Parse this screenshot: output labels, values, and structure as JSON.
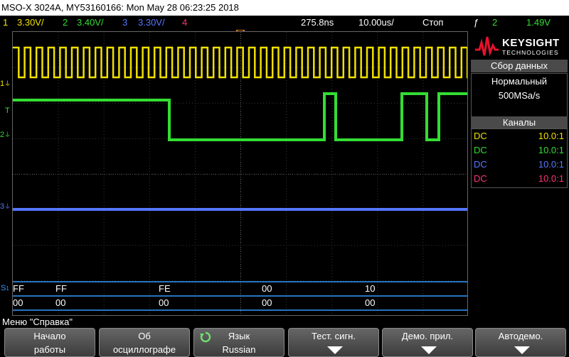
{
  "title": "MSO-X 3024A, MY53160166: Mon May 28 06:23:25 2018",
  "status": {
    "ch1": {
      "num": "1",
      "scale": "3.30V/",
      "color": "#f0e000"
    },
    "ch2": {
      "num": "2",
      "scale": "3.40V/",
      "color": "#33dd33"
    },
    "ch3": {
      "num": "3",
      "scale": "3.30V/",
      "color": "#5577ff"
    },
    "ch4": {
      "num": "4",
      "color": "#ff3377"
    },
    "delay": "275.8ns",
    "timebase": "10.00us/",
    "run_state": "Стоп",
    "trigger_source": "2",
    "trigger_level": "1.49V"
  },
  "markers": {
    "ch1": "1",
    "ch2": "2",
    "ch3": "3",
    "trig": "T",
    "serial": "S"
  },
  "serial_bus": {
    "row1": [
      "FF",
      "FF",
      "FE",
      "00",
      "10"
    ],
    "row2": [
      "00",
      "00",
      "00",
      "00",
      "00"
    ]
  },
  "right_panel": {
    "brand": "KEYSIGHT",
    "brand_sub": "TECHNOLOGIES",
    "acq_header": "Сбор данных",
    "acq_mode": "Нормальный",
    "acq_rate": "500MSa/s",
    "channels_header": "Каналы",
    "channels": [
      {
        "coupling": "DC",
        "probe": "10.0:1",
        "color": "#f0e000"
      },
      {
        "coupling": "DC",
        "probe": "10.0:1",
        "color": "#33dd33"
      },
      {
        "coupling": "DC",
        "probe": "10.0:1",
        "color": "#5577ff"
      },
      {
        "coupling": "DC",
        "probe": "10.0:1",
        "color": "#ff3377"
      }
    ]
  },
  "menu_title": "Меню \"Справка\"",
  "softkeys": [
    {
      "line1": "Начало",
      "line2": "работы"
    },
    {
      "line1": "Об",
      "line2": "осциллографе"
    },
    {
      "line1": "Язык",
      "line2": "Russian"
    },
    {
      "line1": "Тест. сигн."
    },
    {
      "line1": "Демо. прил."
    },
    {
      "line1": "Автодемо."
    }
  ],
  "colors": {
    "ch1": "#f0e000",
    "ch2": "#33dd33",
    "ch3": "#5577ff",
    "ch4": "#ff3377",
    "bus": "#3399ff",
    "trigger": "#ff8800"
  }
}
